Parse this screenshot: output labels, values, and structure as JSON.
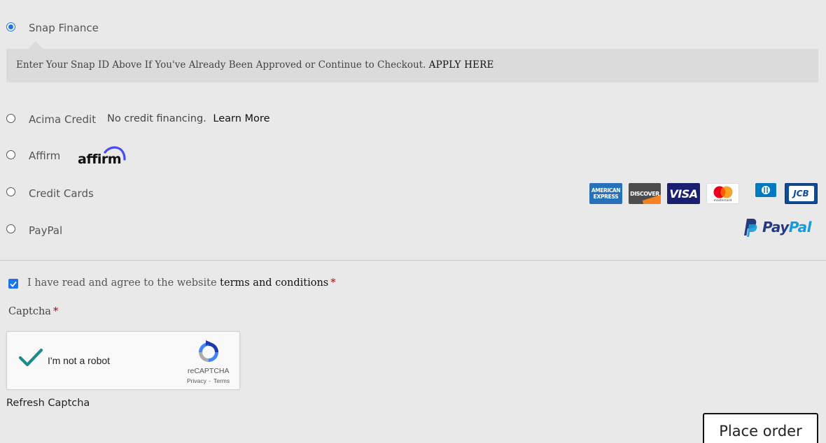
{
  "payment_methods": [
    {
      "label": "Snap Finance",
      "selected": true
    },
    {
      "label": "Acima Credit",
      "selected": false
    },
    {
      "label": "Affirm",
      "selected": false
    },
    {
      "label": "Credit Cards",
      "selected": false
    },
    {
      "label": "PayPal",
      "selected": false
    }
  ],
  "snap": {
    "info_text": "Enter Your Snap ID Above If You've Already Been Approved or Continue to Checkout.",
    "apply_link": "APPLY HERE"
  },
  "acima": {
    "description": "No credit financing.",
    "learn_more": "Learn More"
  },
  "affirm": {
    "logo_text": "affirm"
  },
  "credit_cards": {
    "logos": [
      {
        "name": "American Express",
        "line1": "AMERICAN",
        "line2": "EXPRESS",
        "color": "#2671b9"
      },
      {
        "name": "Discover",
        "text": "DISCOVER",
        "color": "#4d4d4d",
        "accent": "#f58220"
      },
      {
        "name": "Visa",
        "text": "VISA",
        "color": "#1a1f71"
      },
      {
        "name": "Mastercard",
        "text": "mastercard",
        "color": "#ffffff"
      },
      {
        "name": "Diners Club",
        "color": "#0079be"
      },
      {
        "name": "JCB",
        "text": "JCB",
        "color": "#0e4c96"
      }
    ]
  },
  "paypal": {
    "logo_part1": "Pay",
    "logo_part2": "Pal",
    "color_dark": "#253b80",
    "color_light": "#179bd7"
  },
  "terms": {
    "prefix": "I have read and agree to the website",
    "link": "terms and conditions",
    "required_mark": "*",
    "checked": true
  },
  "captcha": {
    "label": "Captcha",
    "required_mark": "*",
    "checkbox_label": "I'm not a robot",
    "brand": "reCAPTCHA",
    "privacy": "Privacy",
    "separator": "-",
    "terms": "Terms",
    "refresh": "Refresh Captcha"
  },
  "place_order": {
    "label": "Place order"
  },
  "colors": {
    "accent": "#1a73e8",
    "background": "#e9e9e9",
    "required": "#b00000"
  }
}
